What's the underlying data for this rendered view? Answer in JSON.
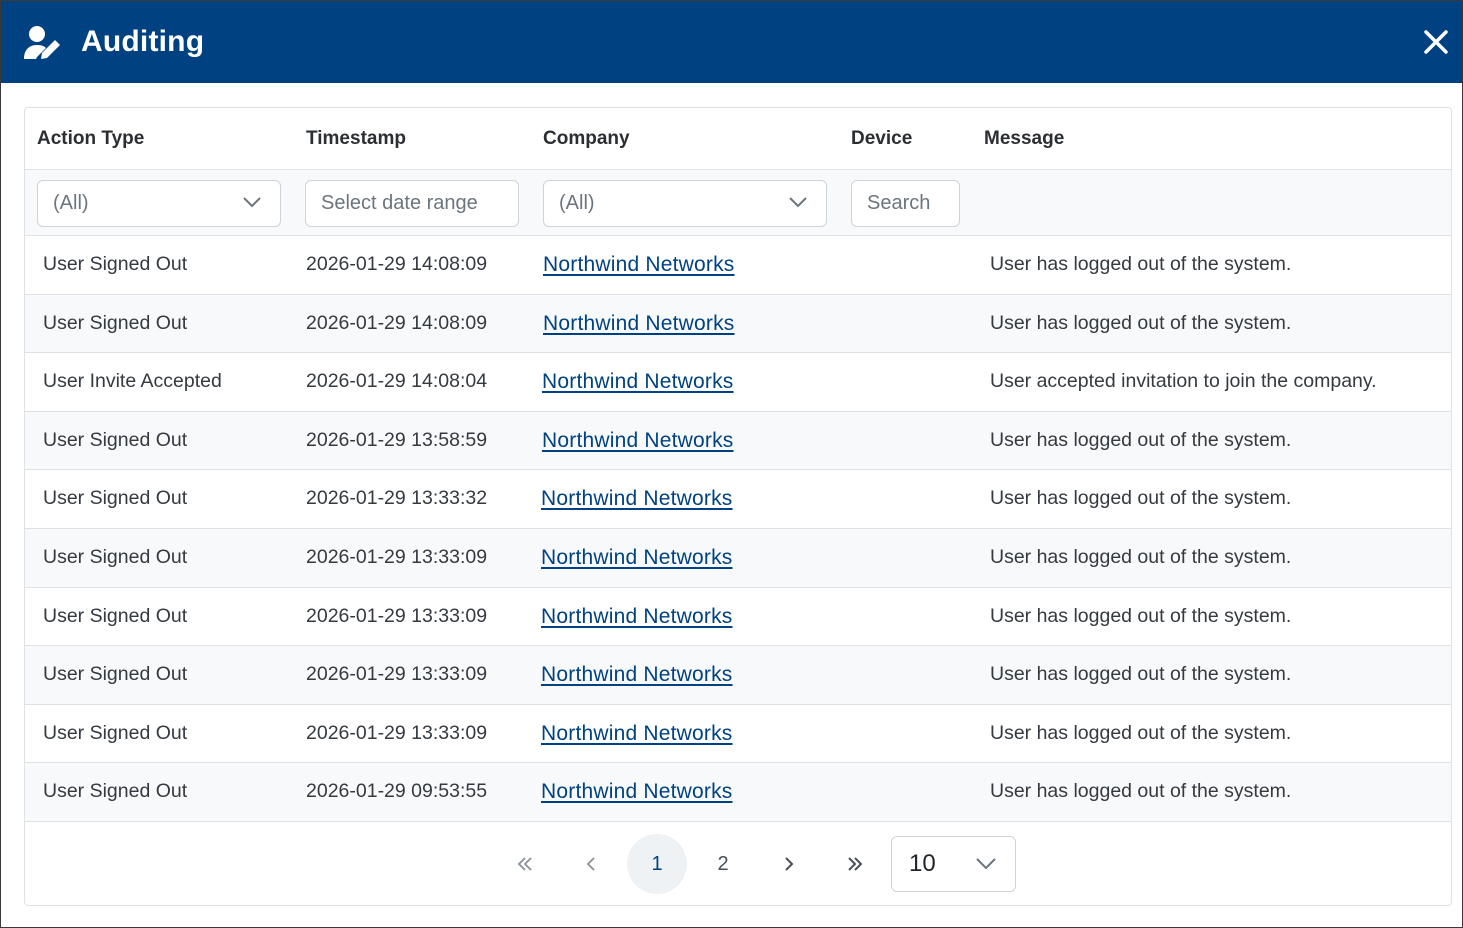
{
  "dialog": {
    "title": "Auditing"
  },
  "columns": [
    "Action Type",
    "Timestamp",
    "Company",
    "Device",
    "Message"
  ],
  "filters": {
    "action_type": "(All)",
    "timestamp_placeholder": "Select date range",
    "company": "(All)",
    "device_placeholder": "Search"
  },
  "rows": [
    {
      "action": "User Signed Out",
      "timestamp": "2026-01-29 14:08:09",
      "company": "Northwind Networks",
      "device": "",
      "message": "User has logged out of the system."
    },
    {
      "action": "User Signed Out",
      "timestamp": "2026-01-29 14:08:09",
      "company": "Northwind Networks",
      "device": "",
      "message": "User has logged out of the system."
    },
    {
      "action": "User Invite Accepted",
      "timestamp": "2026-01-29 14:08:04",
      "company": "Northwind Networks",
      "device": "",
      "message": "User accepted invitation to join the company."
    },
    {
      "action": "User Signed Out",
      "timestamp": "2026-01-29 13:58:59",
      "company": "Northwind Networks",
      "device": "",
      "message": "User has logged out of the system."
    },
    {
      "action": "User Signed Out",
      "timestamp": "2026-01-29 13:33:32",
      "company": "Northwind Networks",
      "device": "",
      "message": "User has logged out of the system."
    },
    {
      "action": "User Signed Out",
      "timestamp": "2026-01-29 13:33:09",
      "company": "Northwind Networks",
      "device": "",
      "message": "User has logged out of the system."
    },
    {
      "action": "User Signed Out",
      "timestamp": "2026-01-29 13:33:09",
      "company": "Northwind Networks",
      "device": "",
      "message": "User has logged out of the system."
    },
    {
      "action": "User Signed Out",
      "timestamp": "2026-01-29 13:33:09",
      "company": "Northwind Networks",
      "device": "",
      "message": "User has logged out of the system."
    },
    {
      "action": "User Signed Out",
      "timestamp": "2026-01-29 13:33:09",
      "company": "Northwind Networks",
      "device": "",
      "message": "User has logged out of the system."
    },
    {
      "action": "User Signed Out",
      "timestamp": "2026-01-29 09:53:55",
      "company": "Northwind Networks",
      "device": "",
      "message": "User has logged out of the system."
    }
  ],
  "pager": {
    "pages": [
      "1",
      "2"
    ],
    "current_page": "1",
    "page_size": "10"
  },
  "icons": {
    "title": "user-edit-icon",
    "close": "close-icon",
    "first": "chevrons-left-icon",
    "prev": "chevron-left-icon",
    "next": "chevron-right-icon",
    "last": "chevrons-right-icon",
    "dropdown": "chevron-down-icon"
  },
  "colors": {
    "header_bg": "#004281",
    "link": "#004281",
    "alt_row": "#f8f9fa"
  }
}
